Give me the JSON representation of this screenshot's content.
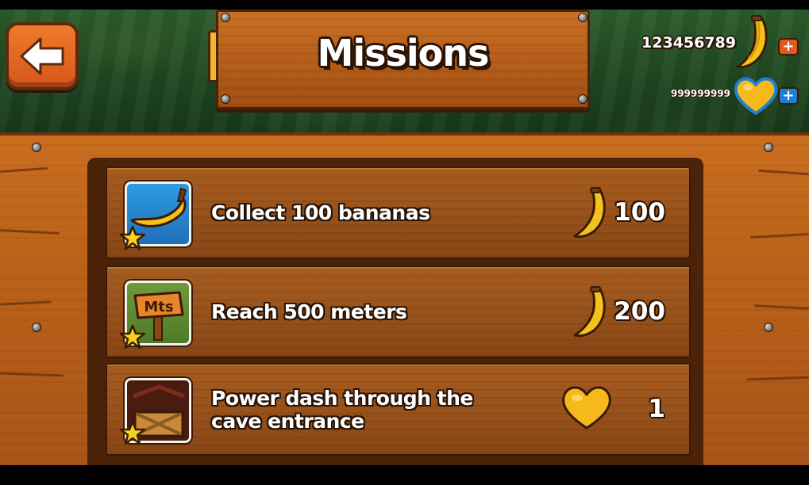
{
  "header": {
    "title": "Missions",
    "bananas_total": "123456789",
    "lives_total": "999999999",
    "plus_label": "+"
  },
  "missions": [
    {
      "text": "Collect 100 bananas",
      "reward": "100",
      "reward_type": "banana",
      "icon": "banana-icon"
    },
    {
      "text": "Reach 500 meters",
      "reward": "200",
      "reward_type": "banana",
      "icon": "meters-sign-icon",
      "icon_label": "Mts"
    },
    {
      "text": "Power dash through the cave entrance",
      "reward": "1",
      "reward_type": "heart",
      "icon": "cave-entrance-icon"
    }
  ],
  "colors": {
    "wood": "#b85f18",
    "wood_dark": "#4a2309",
    "back_button": "#e06a24",
    "banana": "#f5c21b",
    "heart": "#f5b91b",
    "plus_bananas": "#e05a1f",
    "plus_lives": "#1f7fd0"
  }
}
